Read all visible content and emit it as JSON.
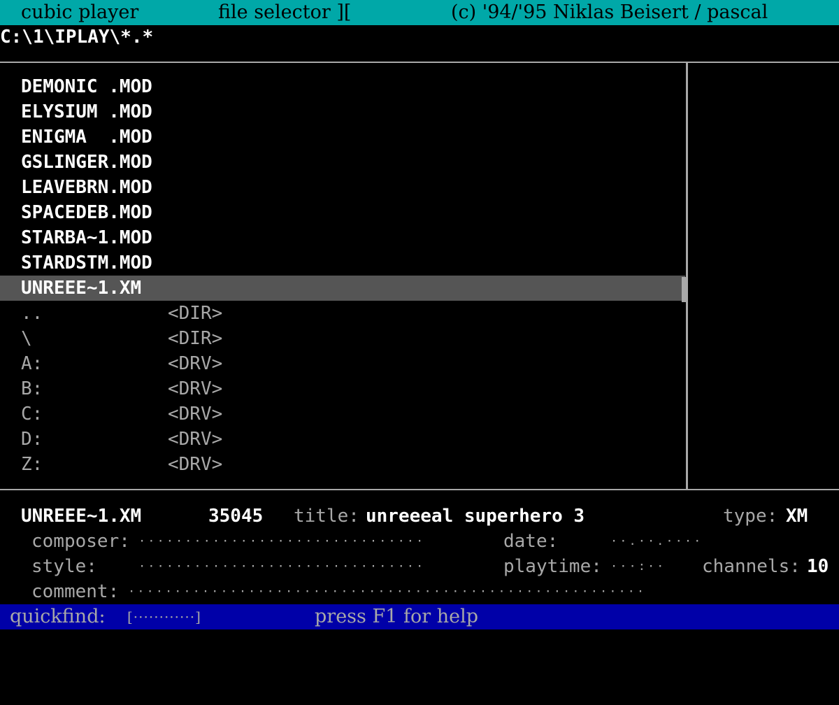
{
  "header": {
    "app_name": "cubic player",
    "screen_name": "file selector ][",
    "copyright": "(c) '94/'95 Niklas Beisert / pascal"
  },
  "path": "C:\\1\\IPLAY\\*.*",
  "files": [
    {
      "name": "DEMONIC .MOD",
      "tag": ""
    },
    {
      "name": "ELYSIUM .MOD",
      "tag": ""
    },
    {
      "name": "ENIGMA  .MOD",
      "tag": ""
    },
    {
      "name": "GSLINGER.MOD",
      "tag": ""
    },
    {
      "name": "LEAVEBRN.MOD",
      "tag": ""
    },
    {
      "name": "SPACEDEB.MOD",
      "tag": ""
    },
    {
      "name": "STARBA~1.MOD",
      "tag": ""
    },
    {
      "name": "STARDSTM.MOD",
      "tag": ""
    },
    {
      "name": "UNREEE~1.XM",
      "tag": ""
    },
    {
      "name": "..",
      "tag": "<DIR>"
    },
    {
      "name": "\\",
      "tag": "<DIR>"
    },
    {
      "name": "A:",
      "tag": "<DRV>"
    },
    {
      "name": "B:",
      "tag": "<DRV>"
    },
    {
      "name": "C:",
      "tag": "<DRV>"
    },
    {
      "name": "D:",
      "tag": "<DRV>"
    },
    {
      "name": "Z:",
      "tag": "<DRV>"
    }
  ],
  "selected_index": 8,
  "info": {
    "filename": "UNREEE~1.XM",
    "size": "35045",
    "title_label": "title:",
    "title_value": "unreeeal superhero 3",
    "type_label": "type:",
    "type_value": "XM",
    "composer_label": "composer:",
    "composer_value": "·······························",
    "date_label": "date:",
    "date_value": "··.··.····",
    "style_label": "style:",
    "style_value": "·······························",
    "playtime_label": "playtime:",
    "playtime_value": "···:··",
    "channels_label": "channels:",
    "channels_value": "10",
    "comment_label": "comment:",
    "comment_value": "························································"
  },
  "footer": {
    "quickfind_label": "quickfind:",
    "quickfind_value": "[············]",
    "help_text": "press F1 for help"
  },
  "colors": {
    "title_bar": "#00a8a8",
    "quickfind_bar": "#0000a8",
    "selection": "#555555",
    "dim_text": "#a8a8a8"
  }
}
